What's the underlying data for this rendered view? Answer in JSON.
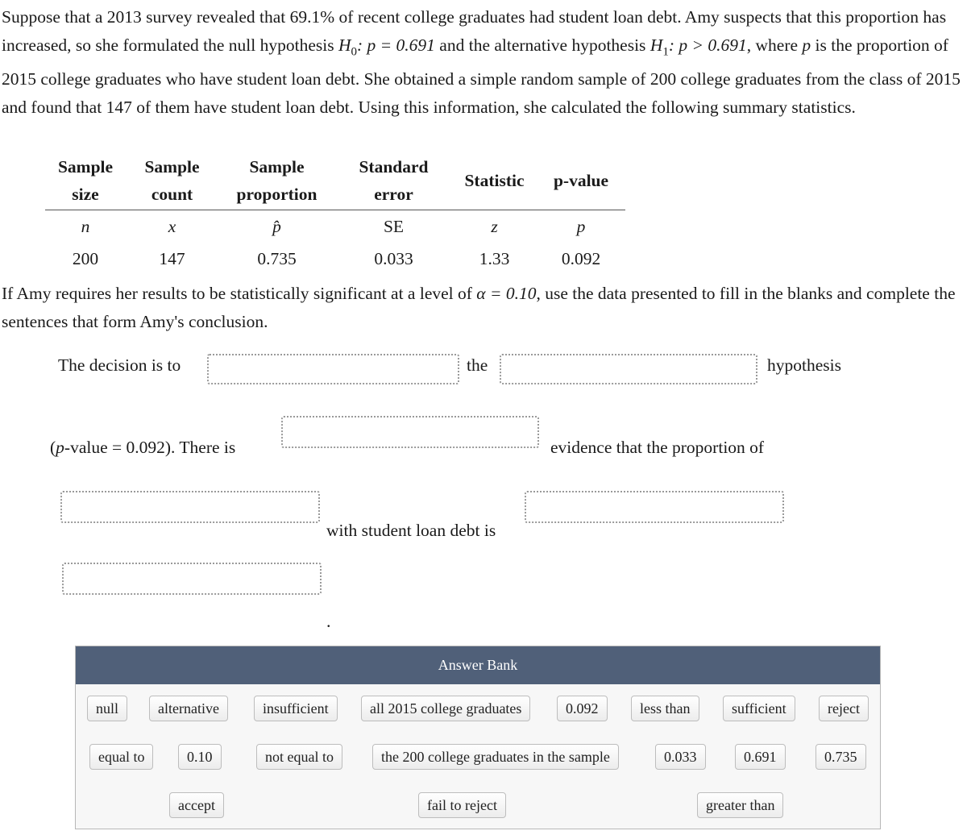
{
  "intro": {
    "s1": "Suppose that a 2013 survey revealed that 69.1% of recent college graduates had student loan debt. Amy suspects that this proportion has increased, so she formulated the null hypothesis ",
    "h0": "H",
    "h0_sub": "0",
    "h0_rest": ": p = 0.691",
    "s2": " and the alternative hypothesis ",
    "h1": "H",
    "h1_sub": "1",
    "h1_rest": ": p > 0.691",
    "s3": ", where ",
    "p": "p",
    "s4": " is the proportion of 2015 college graduates who have student loan debt. She obtained a simple random sample of 200 college graduates from the class of 2015 and found that 147 of them have student loan debt. Using this information, she calculated the following summary statistics."
  },
  "table": {
    "headers": [
      [
        "Sample",
        "size"
      ],
      [
        "Sample",
        "count"
      ],
      [
        "Sample",
        "proportion"
      ],
      [
        "Standard",
        "error"
      ],
      [
        "Statistic",
        ""
      ],
      [
        "p-value",
        ""
      ]
    ],
    "symbols": [
      "n",
      "x",
      "p̂",
      "SE",
      "z",
      "p"
    ],
    "values": [
      "200",
      "147",
      "0.735",
      "0.033",
      "1.33",
      "0.092"
    ]
  },
  "question": {
    "s1": "If Amy requires her results to be statistically significant at a level of ",
    "alpha": "α = 0.10",
    "s2": ", use the data presented to fill in the blanks and complete the sentences that form Amy's conclusion."
  },
  "sentence": {
    "decision_is_to": "The decision is to",
    "the": "the",
    "hypothesis": "hypothesis",
    "pvalue_open": "(",
    "pvalue_p": "p",
    "pvalue_rest": "-value = 0.092). There is",
    "evidence": "evidence that the proportion of",
    "with_debt": "with student loan debt is",
    "period": "."
  },
  "answer_bank": {
    "title": "Answer Bank",
    "row1": [
      "null",
      "alternative",
      "insufficient",
      "all 2015 college graduates",
      "0.092",
      "less than",
      "sufficient",
      "reject"
    ],
    "row2": [
      "equal to",
      "0.10",
      "not equal to",
      "the 200 college graduates in the sample",
      "0.033",
      "0.691",
      "0.735"
    ],
    "row3": [
      "accept",
      "fail to reject",
      "greater than"
    ]
  }
}
